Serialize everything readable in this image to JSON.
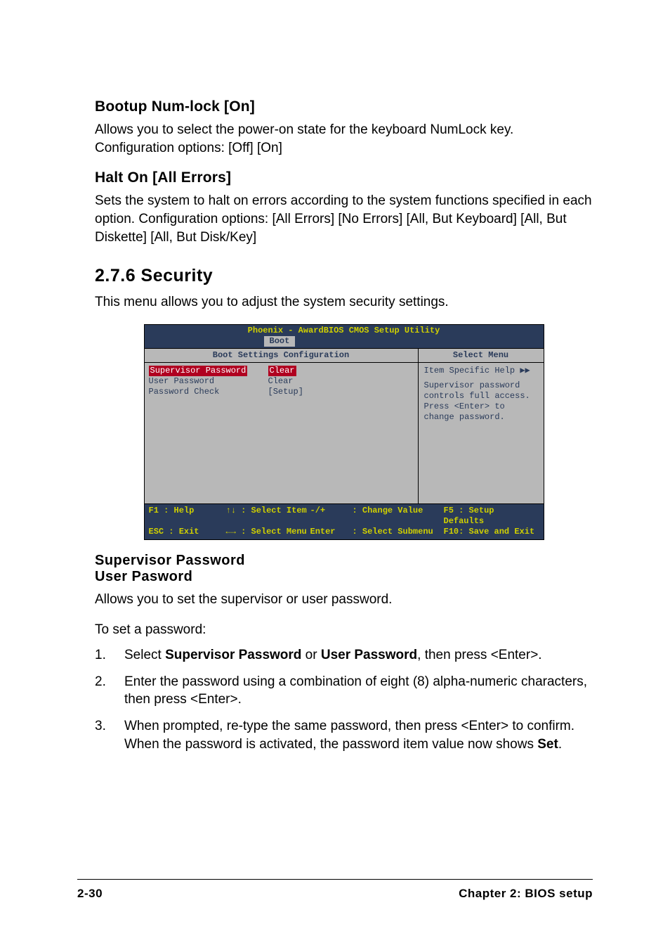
{
  "sections": {
    "numlock": {
      "heading": "Bootup Num-lock [On]",
      "body": "Allows you to select the power-on state for the keyboard NumLock key. Configuration options: [Off] [On]"
    },
    "halton": {
      "heading": "Halt On [All Errors]",
      "body": "Sets the system to halt on errors according to the system functions specified in each option. Configuration options: [All Errors] [No Errors] [All, But Keyboard] [All, But Diskette] [All, But Disk/Key]"
    },
    "security": {
      "heading": "2.7.6   Security",
      "intro": "This menu allows you to adjust the system security settings."
    },
    "passwords": {
      "heading1": "Supervisor Password",
      "heading2": "User Pasword",
      "body": "Allows you to set the supervisor or user password.",
      "lead": "To set a password:",
      "steps": [
        {
          "num": "1.",
          "pre": "Select ",
          "bold1": "Supervisor Password",
          "mid": " or ",
          "bold2": "User Password",
          "post": ", then press <Enter>."
        },
        {
          "num": "2.",
          "text": "Enter the password using a combination of eight (8) alpha-numeric characters, then press <Enter>."
        },
        {
          "num": "3.",
          "pre": "When prompted, re-type the same password, then press <Enter> to confirm. When the password is activated, the password item value now shows ",
          "bold1": "Set",
          "post": "."
        }
      ]
    }
  },
  "bios": {
    "title": "Phoenix - AwardBIOS CMOS Setup Utility",
    "tab": "Boot",
    "header_left": "Boot Settings Configuration",
    "header_right": "Select Menu",
    "items": [
      {
        "label": "Supervisor Password",
        "value": "Clear",
        "selected": true
      },
      {
        "label": "User Password",
        "value": "Clear",
        "selected": false
      },
      {
        "label": "Password Check",
        "value": "[Setup]",
        "selected": false
      }
    ],
    "help_title": "Item Specific Help",
    "help_arrows": "▶▶",
    "help_body": "Supervisor password controls full access. Press <Enter> to change password.",
    "footer": {
      "row1": {
        "c1": "F1  : Help",
        "c2": "↑↓ : Select Item",
        "c3": "-/+",
        "c4": ": Change Value",
        "c5": "F5 : Setup Defaults"
      },
      "row2": {
        "c1": "ESC : Exit",
        "c2": "←→ : Select Menu",
        "c3": "Enter",
        "c4": ": Select Submenu",
        "c5": "F10: Save and Exit"
      }
    }
  },
  "page_footer": {
    "left": "2-30",
    "right": "Chapter 2: BIOS setup"
  }
}
